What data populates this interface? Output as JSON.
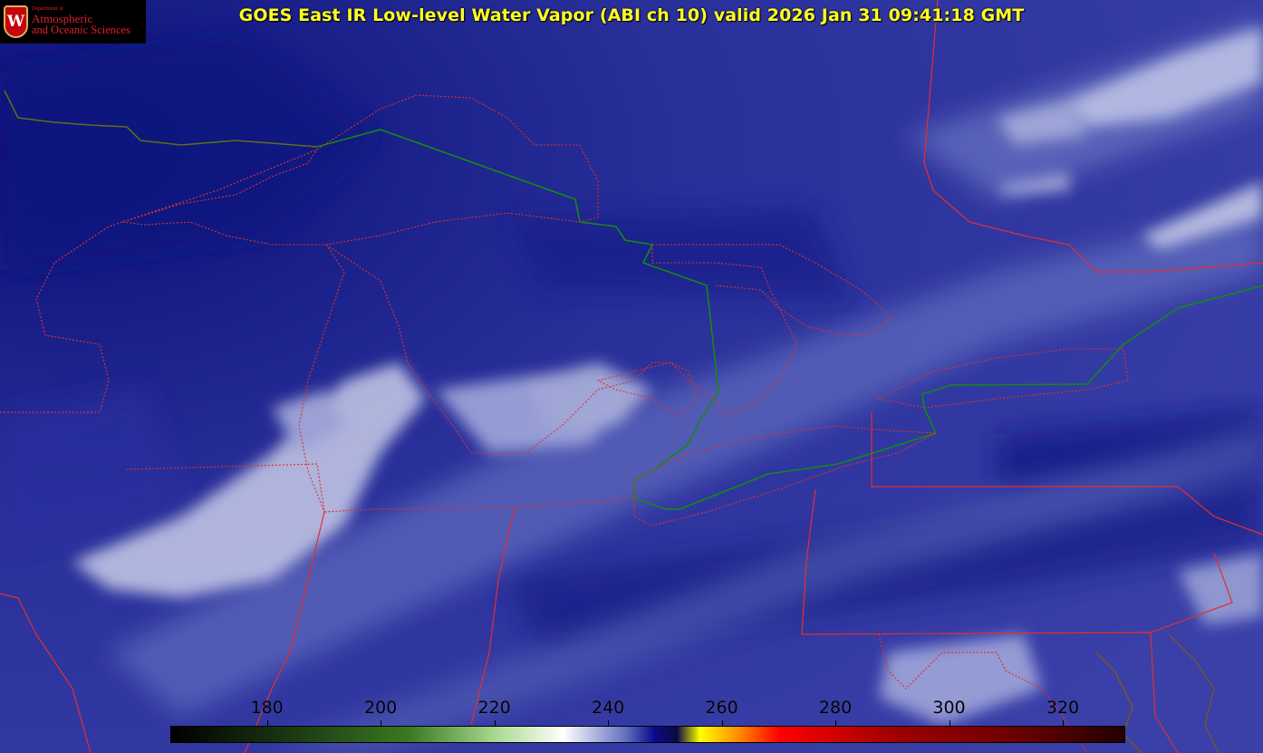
{
  "title": "GOES East IR Low-level Water Vapor (ABI ch 10) valid 2026 Jan 31 09:41:18 GMT",
  "logo": {
    "emblem_letter": "W",
    "department": "Department of",
    "line1": "Atmospheric",
    "line2": "and Oceanic Sciences"
  },
  "colorbar": {
    "ticks": [
      "180",
      "200",
      "220",
      "240",
      "260",
      "280",
      "300",
      "320"
    ],
    "range": [
      163,
      331
    ],
    "stops": [
      {
        "value": 163,
        "color": "#000000"
      },
      {
        "value": 185,
        "color": "#1c3a14"
      },
      {
        "value": 205,
        "color": "#3a7a22"
      },
      {
        "value": 220,
        "color": "#a8d890"
      },
      {
        "value": 232,
        "color": "#ffffff"
      },
      {
        "value": 243,
        "color": "#6070c0"
      },
      {
        "value": 248,
        "color": "#0a0a8a"
      },
      {
        "value": 252,
        "color": "#0a0a40"
      },
      {
        "value": 256,
        "color": "#ffff00"
      },
      {
        "value": 263,
        "color": "#ff8800"
      },
      {
        "value": 270,
        "color": "#ff0000"
      },
      {
        "value": 290,
        "color": "#a00000"
      },
      {
        "value": 310,
        "color": "#700000"
      },
      {
        "value": 331,
        "color": "#200000"
      }
    ]
  },
  "colors": {
    "background": "#1a1f8c",
    "cloud": "#c8cce8",
    "state_border": "#e03030",
    "intl_border": "#138a13",
    "coast": "#7a5a1a"
  }
}
